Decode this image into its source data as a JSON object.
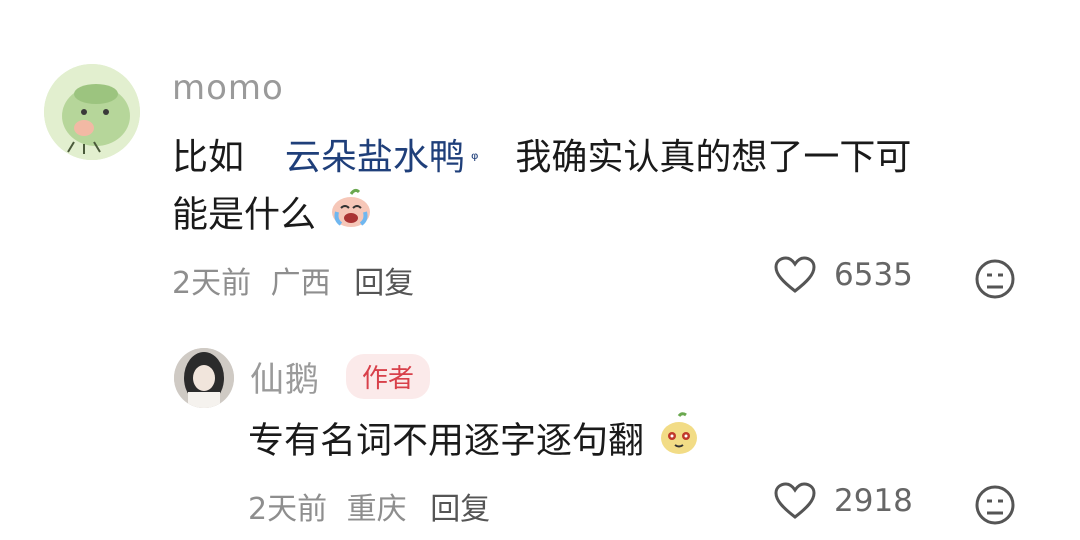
{
  "comments": [
    {
      "username": "momo",
      "text_prefix": "比如",
      "keyword": "云朵盐水鸭",
      "text_line1_rest": "我确实认真的想了一下可",
      "text_line2": "能是什么",
      "time": "2天前",
      "location": "广西",
      "reply_label": "回复",
      "likes": "6535",
      "avatar_icon": "green-bun-avatar",
      "emoji_icon": "crying-face-emoji"
    }
  ],
  "reply": {
    "username": "仙鹅",
    "badge": "作者",
    "text": "专有名词不用逐字逐句翻",
    "time": "2天前",
    "location": "重庆",
    "reply_label": "回复",
    "likes": "2918",
    "avatar_icon": "girl-photo-avatar",
    "emoji_icon": "smirk-pear-emoji"
  },
  "colors": {
    "keyword": "#1f3f7a",
    "badge_bg": "#fbeaea",
    "badge_text": "#d8404a",
    "meta": "#8e8e8e"
  }
}
